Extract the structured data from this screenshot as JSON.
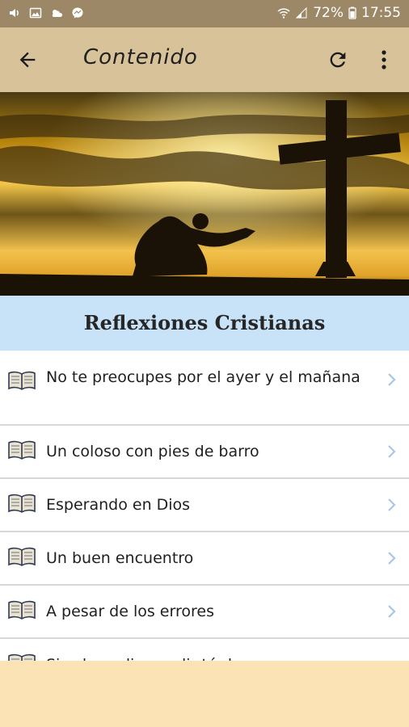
{
  "status": {
    "battery": "72%",
    "time": "17:55"
  },
  "appbar": {
    "title": "Contenido"
  },
  "section": {
    "title": "Reflexiones Cristianas"
  },
  "items": [
    {
      "label": "No te preocupes por el ayer y el mañana"
    },
    {
      "label": "Un coloso con pies de barro"
    },
    {
      "label": "Esperando en Dios"
    },
    {
      "label": "Un buen encuentro"
    },
    {
      "label": "A pesar de los errores"
    },
    {
      "label": "Si solo pudiera salir tú de..."
    }
  ],
  "colors": {
    "appbar": "#d8c29a",
    "statusbar": "#9c8867",
    "section": "#c8e2f8",
    "background": "#fbe3b6"
  },
  "icons": {
    "back": "arrow-left-icon",
    "refresh": "refresh-icon",
    "more": "more-vert-icon",
    "book": "book-icon",
    "chevron": "chevron-right-icon"
  }
}
